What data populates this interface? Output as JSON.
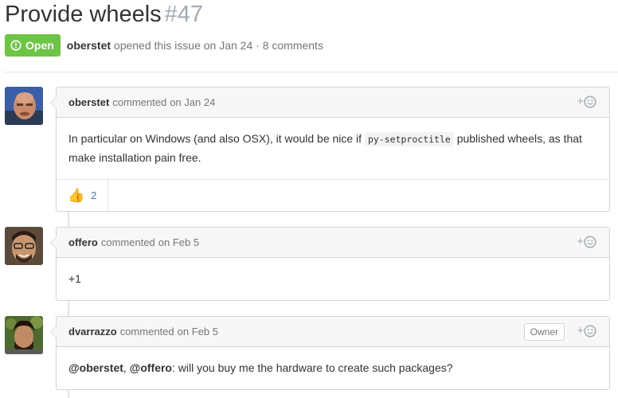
{
  "issue": {
    "title": "Provide wheels",
    "number": "#47",
    "state": "Open",
    "author": "oberstet",
    "opened_text": "opened this issue on Jan 24 · 8 comments"
  },
  "colors": {
    "open_badge": "#6cc644",
    "link": "#4078c0",
    "muted": "#767676"
  },
  "comments": [
    {
      "author": "oberstet",
      "action": "commented",
      "date": "on Jan 24",
      "body_before": "In particular on Windows (and also OSX), it would be nice if ",
      "body_code": "py-setproctitle",
      "body_after": " published wheels, as that make installation pain free.",
      "reactions": [
        {
          "emoji": "👍",
          "count": "2"
        }
      ]
    },
    {
      "author": "offero",
      "action": "commented",
      "date": "on Feb 5",
      "body": "+1"
    },
    {
      "author": "dvarrazzo",
      "action": "commented",
      "date": "on Feb 5",
      "badge": "Owner",
      "mention_1": "@oberstet",
      "sep": ", ",
      "mention_2": "@offero",
      "body_rest": ": will you buy me the hardware to create such packages?"
    }
  ],
  "icons": {
    "reaction_add": "smiley-plus-icon",
    "state": "issue-opened-icon"
  }
}
